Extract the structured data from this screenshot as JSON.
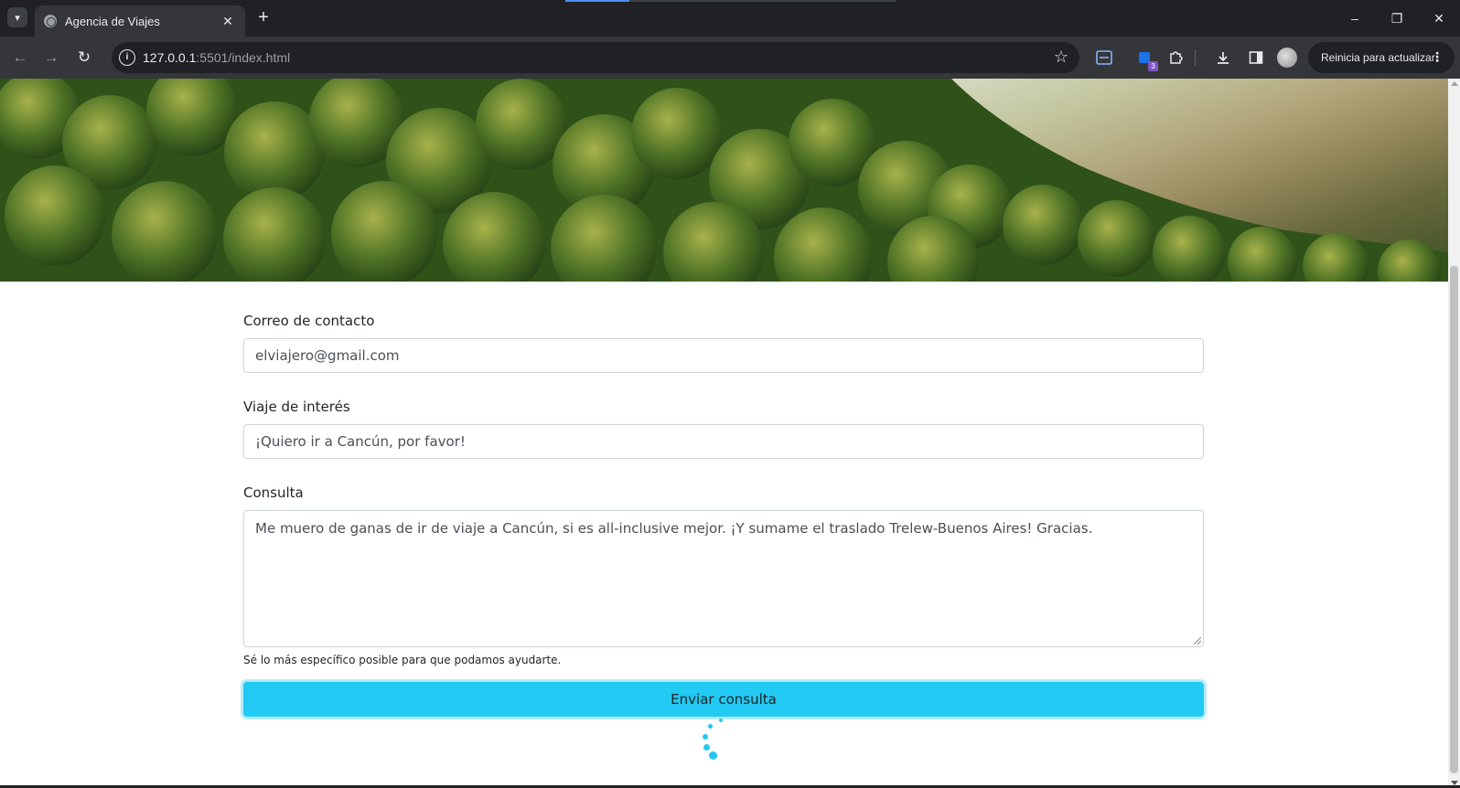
{
  "browser": {
    "tab_title": "Agencia de Viajes",
    "close_tab_glyph": "✕",
    "new_tab_glyph": "+",
    "url_host": "127.0.0.1",
    "url_rest": ":5501/index.html",
    "update_button_label": "Reinicia para actualizar",
    "extension_badge": "3",
    "window_controls": [
      "–",
      "❐",
      "✕"
    ]
  },
  "form": {
    "email_label": "Correo de contacto",
    "email_value": "elviajero@gmail.com",
    "trip_label": "Viaje de interés",
    "trip_value": "¡Quiero ir a Cancún, por favor!",
    "query_label": "Consulta",
    "query_value": "Me muero de ganas de ir de viaje a Cancún, si es all-inclusive mejor. ¡Y sumame el traslado Trelew-Buenos Aires! Gracias.",
    "query_help": "Sé lo más específico posible para que podamos ayudarte.",
    "submit_label": "Enviar consulta"
  },
  "colors": {
    "accent": "#22c9f2",
    "browser_dark": "#202124",
    "toolbar": "#35363a"
  },
  "icons": {
    "tab_search": "chevron-down-icon",
    "favicon": "globe-icon",
    "back": "arrow-left-icon",
    "forward": "arrow-right-icon",
    "reload": "reload-icon",
    "site_info": "info-icon",
    "bookmark": "star-icon",
    "download": "download-icon",
    "side_panel": "side-panel-icon",
    "extensions": "puzzle-icon",
    "more": "more-vertical-icon",
    "spinner": "loading-spinner-icon"
  }
}
